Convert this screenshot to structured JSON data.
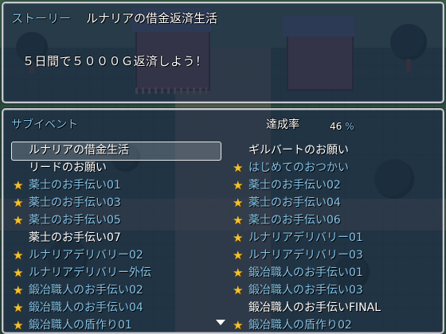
{
  "story": {
    "label": "ストーリー",
    "title": "ルナリアの借金返済生活",
    "goal": "５日間で５０００Ｇ返済しよう！"
  },
  "subevents": {
    "header": "サブイベント",
    "completion_label": "達成率",
    "completion_value": "46",
    "completion_unit": "%",
    "completion_percent": 46,
    "selected_index": 0,
    "colors": {
      "star": "#f2c230",
      "completed_text": "#84c3e6",
      "normal_text": "#ffffff"
    },
    "left": [
      {
        "label": "ルナリアの借金生活",
        "completed": false
      },
      {
        "label": "リードのお願い",
        "completed": false
      },
      {
        "label": "薬士のお手伝い01",
        "completed": true
      },
      {
        "label": "薬士のお手伝い03",
        "completed": true
      },
      {
        "label": "薬士のお手伝い05",
        "completed": true
      },
      {
        "label": "薬士のお手伝い07",
        "completed": false
      },
      {
        "label": "ルナリアデリバリー02",
        "completed": true
      },
      {
        "label": "ルナリアデリバリー外伝",
        "completed": true
      },
      {
        "label": "鍛冶職人のお手伝い02",
        "completed": true
      },
      {
        "label": "鍛冶職人のお手伝い04",
        "completed": true
      },
      {
        "label": "鍛冶職人の盾作り01",
        "completed": true
      }
    ],
    "right": [
      {
        "label": "ギルバートのお願い",
        "completed": false
      },
      {
        "label": "はじめてのおつかい",
        "completed": true
      },
      {
        "label": "薬士のお手伝い02",
        "completed": true
      },
      {
        "label": "薬士のお手伝い04",
        "completed": true
      },
      {
        "label": "薬士のお手伝い06",
        "completed": true
      },
      {
        "label": "ルナリアデリバリー01",
        "completed": true
      },
      {
        "label": "ルナリアデリバリー03",
        "completed": true
      },
      {
        "label": "鍛冶職人のお手伝い01",
        "completed": true
      },
      {
        "label": "鍛冶職人のお手伝い03",
        "completed": true
      },
      {
        "label": "鍛冶職人のお手伝いFINAL",
        "completed": false
      },
      {
        "label": "鍛冶職人の盾作り02",
        "completed": true
      }
    ]
  }
}
